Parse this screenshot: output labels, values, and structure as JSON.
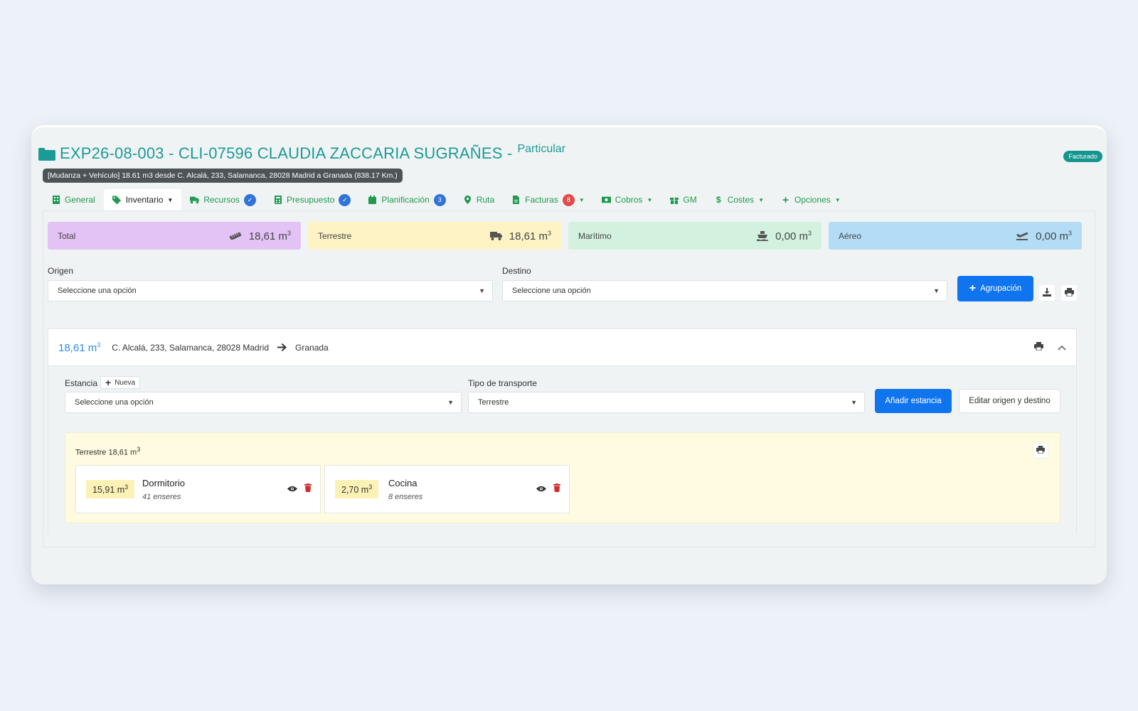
{
  "header": {
    "title": "EXP26-08-003 - CLI-07596 CLAUDIA ZACCARIA SUGRAÑES -",
    "client_type": "Particular",
    "status_badge": "Facturado",
    "summary": "[Mudanza + Vehículo] 18.61 m3 desde C. Alcalá, 233, Salamanca, 28028 Madrid a Granada (838.17 Km.)"
  },
  "tabs": [
    {
      "label": "General",
      "icon": "building-icon"
    },
    {
      "label": "Inventario",
      "icon": "tags-icon",
      "active": true
    },
    {
      "label": "Recursos",
      "icon": "truck-icon",
      "badge": "check"
    },
    {
      "label": "Presupuesto",
      "icon": "calculator-icon",
      "badge": "check"
    },
    {
      "label": "Planificación",
      "icon": "calendar-icon",
      "badge": "3"
    },
    {
      "label": "Ruta",
      "icon": "map-pin-icon"
    },
    {
      "label": "Facturas",
      "icon": "file-invoice-icon",
      "badge": "8"
    },
    {
      "label": "Cobros",
      "icon": "money-icon"
    },
    {
      "label": "GM",
      "icon": "gift-icon"
    },
    {
      "label": "Costes",
      "icon": "dollar-icon"
    },
    {
      "label": "Opciones",
      "icon": "plus-icon"
    }
  ],
  "volumes": {
    "total": {
      "label": "Total",
      "value": "18,61 m"
    },
    "terrestre": {
      "label": "Terrestre",
      "value": "18,61 m"
    },
    "maritimo": {
      "label": "Marítimo",
      "value": "0,00 m"
    },
    "aereo": {
      "label": "Aéreo",
      "value": "0,00 m"
    },
    "unit_sup": "3"
  },
  "filters": {
    "origen_label": "Origen",
    "origen_value": "Seleccione una opción",
    "destino_label": "Destino",
    "destino_value": "Seleccione una opción",
    "agrupacion_button": "Agrupación"
  },
  "group": {
    "volume": "18,61 m",
    "origin": "C. Alcalá, 233, Salamanca, 28028 Madrid",
    "destination": "Granada",
    "estancia_label": "Estancia",
    "nueva_label": "Nueva",
    "estancia_value": "Seleccione una opción",
    "transport_label": "Tipo de transporte",
    "transport_value": "Terrestre",
    "add_button": "Añadir estancia",
    "edit_button": "Editar origen y destino",
    "terrestre_title": "Terrestre 18,61 m",
    "rooms": [
      {
        "volume": "15,91 m",
        "name": "Dormitorio",
        "count": "41 enseres"
      },
      {
        "volume": "2,70 m",
        "name": "Cocina",
        "count": "8 enseres"
      }
    ]
  },
  "colors": {
    "brand": "#1a9b96",
    "tab_green": "#1f9a4e",
    "primary": "#1174ef",
    "total_card": "#e3c2f5",
    "terrestre_card": "#fdf3c4",
    "maritimo_card": "#d2f1df",
    "aereo_card": "#b3ddf6"
  }
}
